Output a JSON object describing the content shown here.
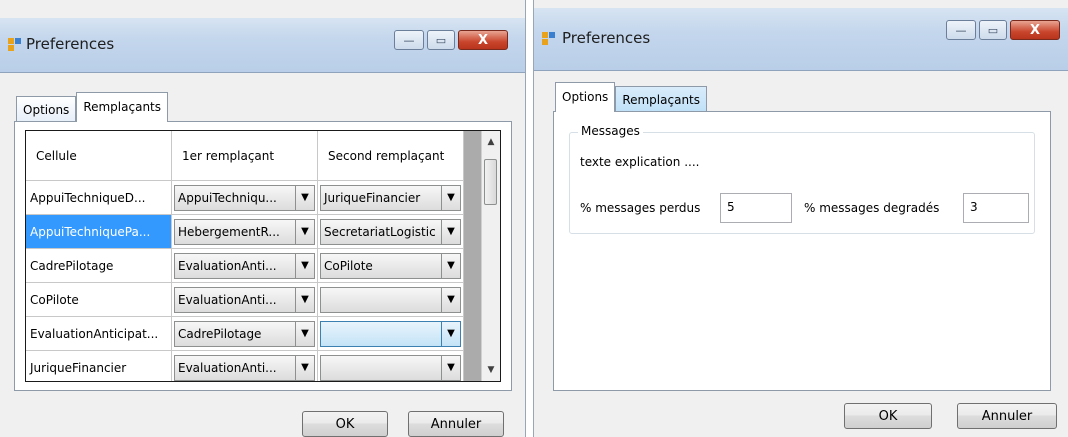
{
  "left": {
    "title": "Preferences",
    "window_buttons": {
      "minimize": "—",
      "maximize": "▭",
      "close": "X"
    },
    "tabs": [
      {
        "label": "Options",
        "active": false
      },
      {
        "label": "Remplaçants",
        "active": true
      }
    ],
    "grid": {
      "headers": [
        "Cellule",
        "1er remplaçant",
        "Second remplaçant"
      ],
      "rows": [
        {
          "cellule": "AppuiTechniqueD...",
          "first": "AppuiTechniqu...",
          "second": "JuriqueFinancier",
          "selected": false
        },
        {
          "cellule": "AppuiTechniquePa...",
          "first": "HebergementR...",
          "second": "SecretariatLogistic",
          "selected": true
        },
        {
          "cellule": "CadrePilotage",
          "first": "EvaluationAnti...",
          "second": "CoPilote",
          "selected": false
        },
        {
          "cellule": "CoPilote",
          "first": "EvaluationAnti...",
          "second": "",
          "selected": false
        },
        {
          "cellule": "EvaluationAnticipat...",
          "first": "CadrePilotage",
          "second": "",
          "selected": false
        },
        {
          "cellule": "JuriqueFinancier",
          "first": "EvaluationAnti...",
          "second": "",
          "selected": false
        }
      ]
    },
    "ok": "OK",
    "cancel": "Annuler"
  },
  "right": {
    "title": "Preferences",
    "window_buttons": {
      "minimize": "—",
      "maximize": "▭",
      "close": "X"
    },
    "tabs": [
      {
        "label": "Options",
        "active": true
      },
      {
        "label": "Remplaçants",
        "active": false
      }
    ],
    "group_title": "Messages",
    "explanation": "texte explication ....",
    "lost_label": "% messages perdus",
    "lost_value": "5",
    "degraded_label": "% messages degradés",
    "degraded_value": "3",
    "ok": "OK",
    "cancel": "Annuler"
  },
  "colors": {
    "selection": "#3399ff",
    "close_button": "#c9462c",
    "title_bar": "#c3d6ec"
  }
}
